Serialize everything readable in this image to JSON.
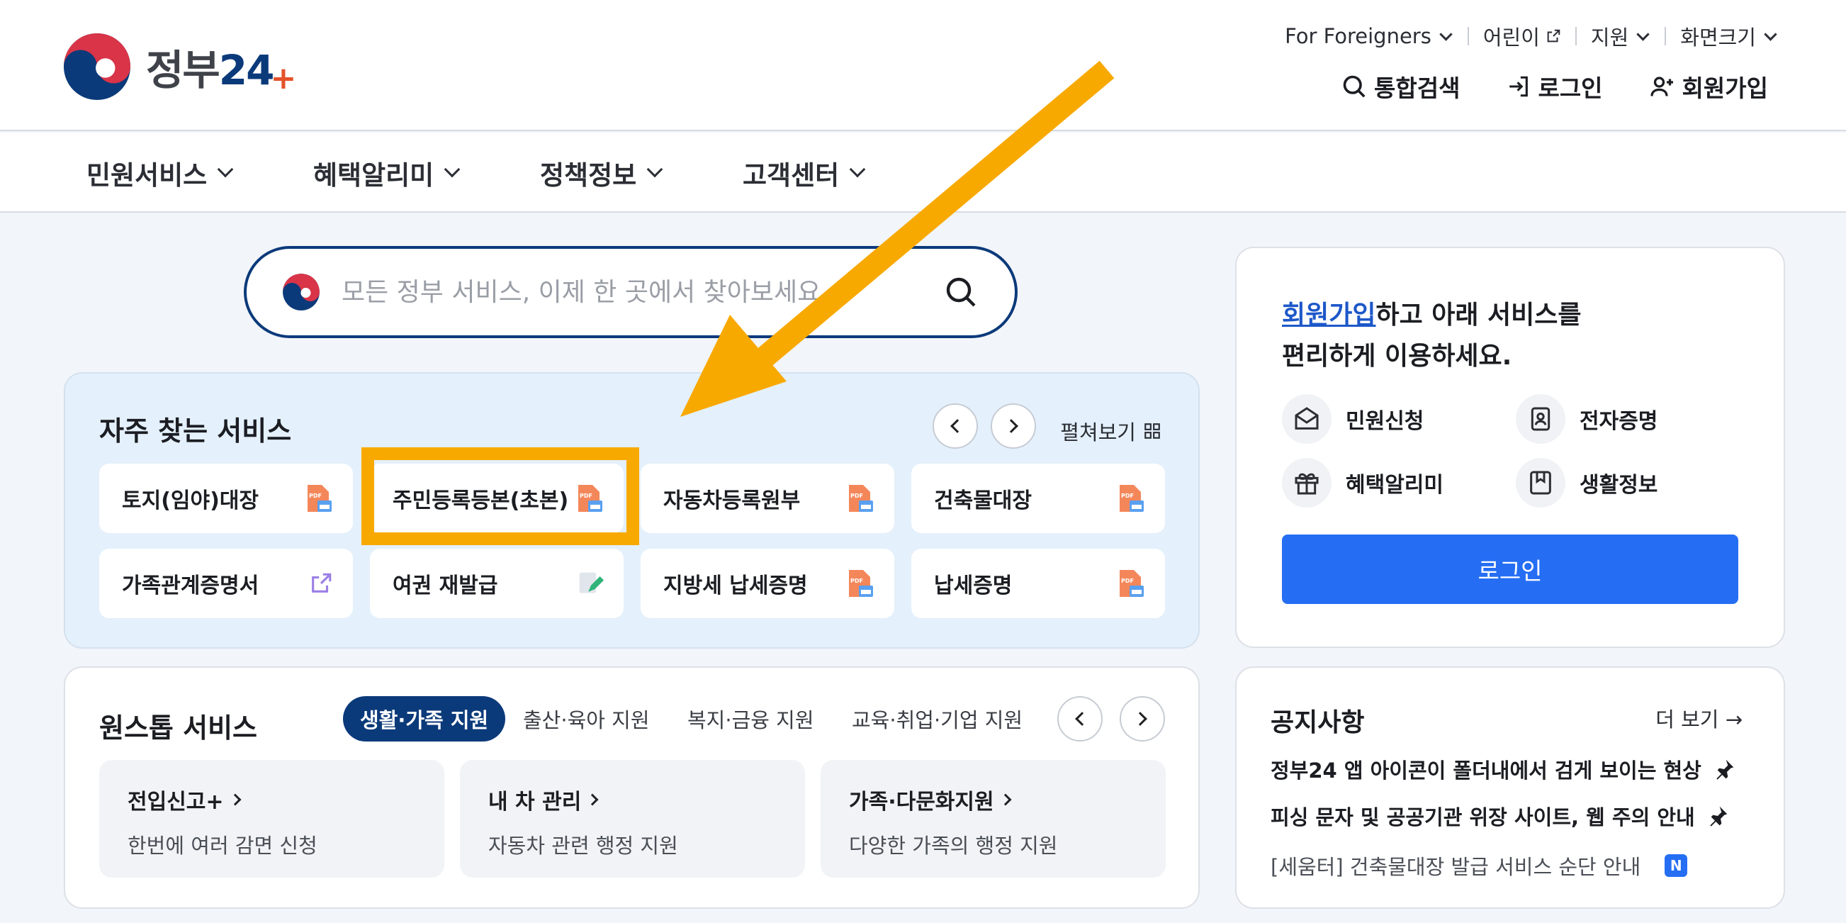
{
  "header": {
    "logo_text": "정부",
    "logo_num": "24",
    "logo_plus": "+",
    "util": [
      {
        "label": "For Foreigners",
        "icon": "chevron-down-icon"
      },
      {
        "label": "어린이",
        "icon": "external-link-icon"
      },
      {
        "label": "지원",
        "icon": "chevron-down-icon"
      },
      {
        "label": "화면크기",
        "icon": "chevron-down-icon"
      }
    ],
    "actions": [
      {
        "label": "통합검색",
        "icon": "search-icon"
      },
      {
        "label": "로그인",
        "icon": "login-icon"
      },
      {
        "label": "회원가입",
        "icon": "user-add-icon"
      }
    ]
  },
  "gnb": [
    "민원서비스",
    "혜택알리미",
    "정책정보",
    "고객센터"
  ],
  "search": {
    "placeholder": "모든 정부 서비스, 이제 한 곳에서 찾아보세요"
  },
  "frequent": {
    "title": "자주 찾는 서비스",
    "expand": "펼쳐보기",
    "items": [
      {
        "label": "토지(임야)대장",
        "icon": "pdf-icon"
      },
      {
        "label": "주민등록등본(초본)",
        "icon": "pdf-icon"
      },
      {
        "label": "자동차등록원부",
        "icon": "pdf-icon"
      },
      {
        "label": "건축물대장",
        "icon": "pdf-icon"
      },
      {
        "label": "가족관계증명서",
        "icon": "external-link-icon"
      },
      {
        "label": "여권 재발급",
        "icon": "edit-icon"
      },
      {
        "label": "지방세 납세증명",
        "icon": "pdf-icon"
      },
      {
        "label": "납세증명",
        "icon": "pdf-icon"
      }
    ]
  },
  "login_panel": {
    "link": "회원가입",
    "msg1": "하고 아래 서비스를",
    "msg2": "편리하게 이용하세요.",
    "items": [
      "민원신청",
      "전자증명",
      "혜택알리미",
      "생활정보"
    ],
    "button": "로그인"
  },
  "onestop": {
    "title": "원스톱 서비스",
    "tabs": [
      "생활·가족 지원",
      "출산·육아 지원",
      "복지·금융 지원",
      "교육·취업·기업 지원"
    ],
    "cards": [
      {
        "title": "전입신고+",
        "sub": "한번에 여러 감면 신청"
      },
      {
        "title": "내 차 관리",
        "sub": "자동차 관련 행정 지원"
      },
      {
        "title": "가족·다문화지원",
        "sub": "다양한 가족의 행정 지원"
      }
    ]
  },
  "notice": {
    "title": "공지사항",
    "more": "더 보기",
    "items": [
      {
        "text": "정부24 앱 아이콘이 폴더내에서 검게 보이는 현상",
        "pinned": true
      },
      {
        "text": "피싱 문자 및 공공기관 위장 사이트, 웹 주의 안내",
        "pinned": true
      },
      {
        "text": "[세움터] 건축물대장 발급 서비스 순단 안내",
        "badge": "N"
      }
    ]
  },
  "colors": {
    "brand_navy": "#0b3a7a",
    "primary_blue": "#256ef4",
    "highlight": "#f8a900",
    "accent_red": "#e4522a"
  }
}
